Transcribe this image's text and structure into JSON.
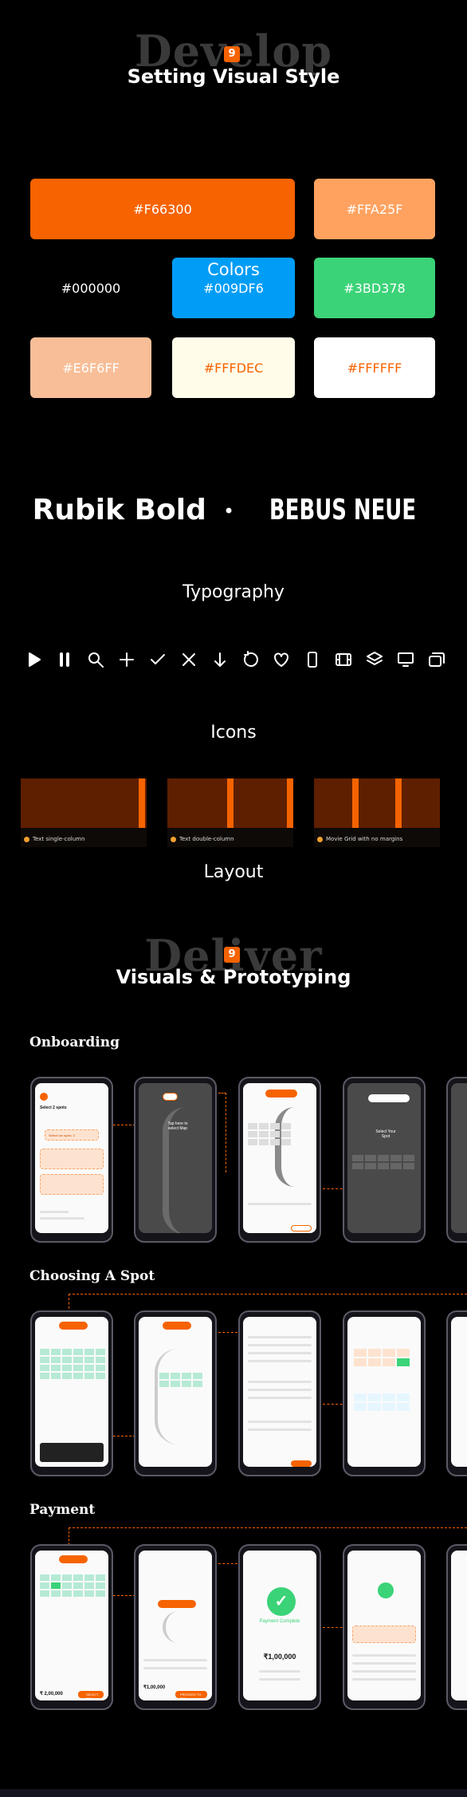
{
  "develop": {
    "ghost": "Develop",
    "badge": "9",
    "subtitle": "Setting Visual Style"
  },
  "colors": {
    "title": "Colors",
    "swatches": [
      {
        "label": "#F66300",
        "bg": "#F66300",
        "fg": "#FFFFFF"
      },
      {
        "label": "#FFA25F",
        "bg": "#FFA25F",
        "fg": "#FFFFFF"
      },
      {
        "label": "#000000",
        "bg": "#000000",
        "fg": "#FFFFFF"
      },
      {
        "label": "#009DF6",
        "bg": "#009DF6",
        "fg": "#FFFFFF"
      },
      {
        "label": "#3BD378",
        "bg": "#3BD378",
        "fg": "#FFFFFF"
      },
      {
        "label": "#E6F6FF",
        "bg": "#F8BE97",
        "fg": "#FFFFFF"
      },
      {
        "label": "#FFFDEC",
        "bg": "#FFFCEA",
        "fg": "#F66300"
      },
      {
        "label": "#FFFFFF",
        "bg": "#FFFFFF",
        "fg": "#F66300"
      }
    ]
  },
  "typography": {
    "font_a": "Rubik Bold",
    "separator": "•",
    "font_b": "BEBUS NEUE",
    "label": "Typography"
  },
  "icons": {
    "items": [
      "play-icon",
      "pause-icon",
      "search-icon",
      "plus-icon",
      "check-icon",
      "close-icon",
      "arrow-down-icon",
      "refresh-icon",
      "heart-icon",
      "phone-icon",
      "film-icon",
      "layers-icon",
      "monitor-icon",
      "windows-icon"
    ],
    "label": "Icons"
  },
  "layout": {
    "grids": [
      {
        "caption": "Text single-column"
      },
      {
        "caption": "Text double-column"
      },
      {
        "caption": "Movie Grid with no margins"
      }
    ],
    "label": "Layout"
  },
  "deliver": {
    "ghost": "Deliver",
    "badge": "9",
    "subtitle": "Visuals & Prototyping"
  },
  "groups": [
    {
      "title": "Onboarding"
    },
    {
      "title": "Choosing A Spot"
    },
    {
      "title": "Payment"
    }
  ],
  "screens": {
    "onboarding_1": {
      "title": "Select 2 spots",
      "banner": "Select car spots: 2"
    },
    "onboarding_2": {
      "tooltip": "Tap here to select Map"
    },
    "onboarding_4": {
      "tooltip": "Select Your Spot"
    },
    "payment_3": {
      "status": "Payment Complete",
      "amount": "₹1,00,000"
    },
    "payment_1": {
      "amount": "₹ 2,00,000",
      "cta": "SELECT PAY"
    },
    "payment_2": {
      "amount": "₹1,00,000",
      "cta": "PROCEED TO PAY"
    }
  },
  "accent": "#F66300"
}
